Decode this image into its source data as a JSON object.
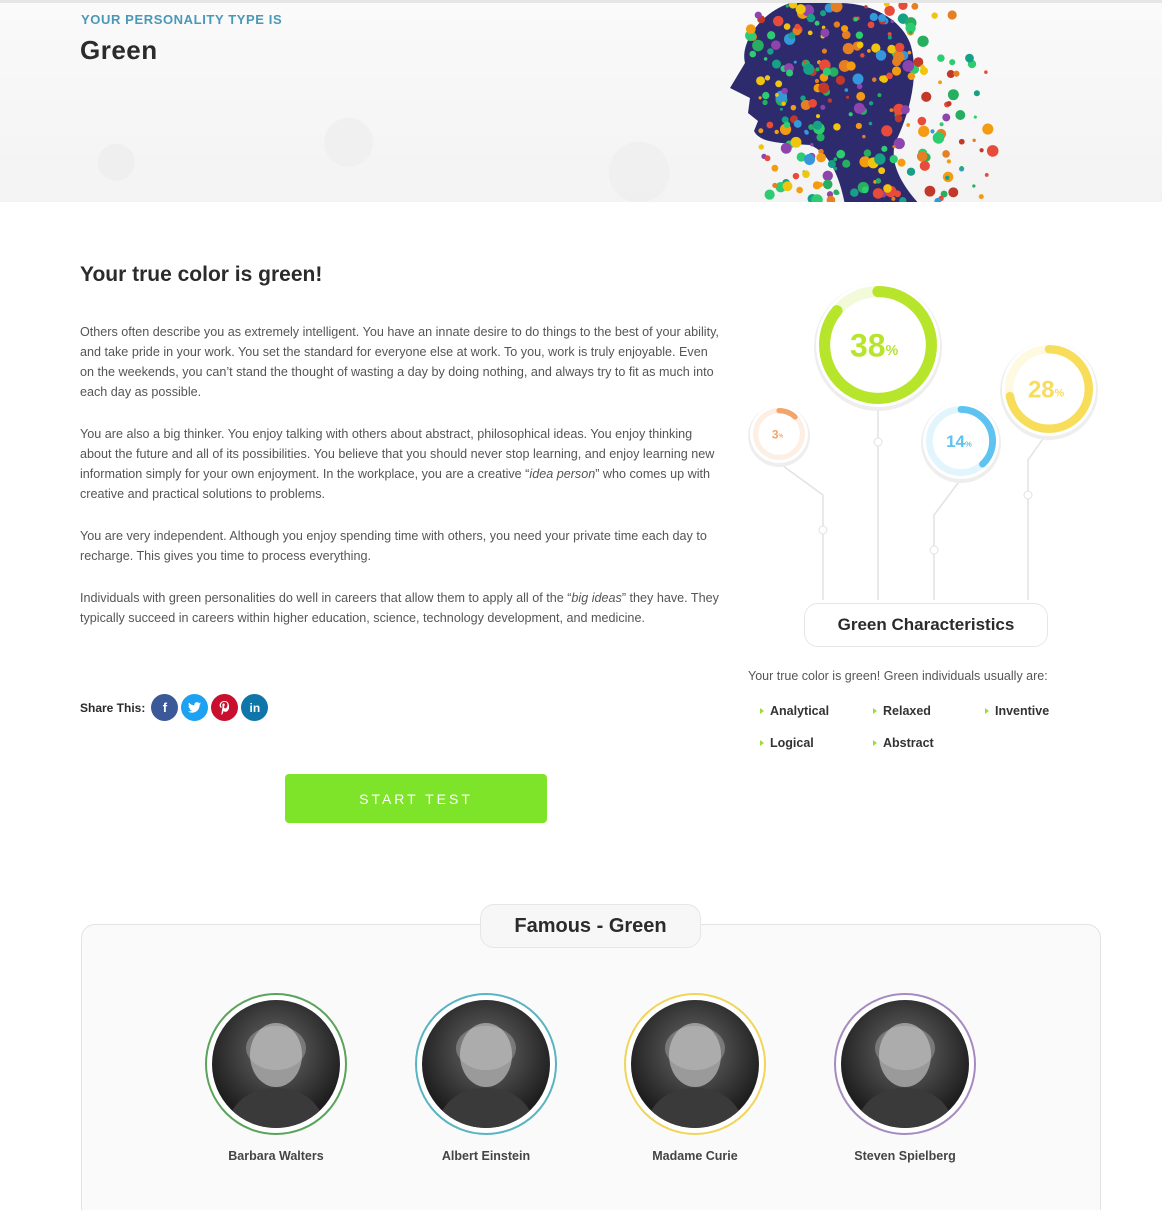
{
  "hero": {
    "kicker": "YOUR PERSONALITY TYPE IS",
    "title": "Green"
  },
  "article": {
    "heading": "Your true color is green!",
    "p1": "Others often describe you as extremely intelligent. You have an innate desire to do things to the best of your ability, and take pride in your work. You set the standard for everyone else at work. To you, work is truly enjoyable. Even on the weekends, you can’t stand the thought of wasting a day by doing nothing, and always try to fit as much into each day as possible.",
    "p2_a": "You are also a big thinker. You enjoy talking with others about abstract, philosophical ideas. You enjoy thinking about the future and all of its possibilities. You believe that you should never stop learning, and enjoy learning new information simply for your own enjoyment. In the workplace, you are a creative “",
    "p2_em": "idea person",
    "p2_b": "” who comes up with creative and practical solutions to problems.",
    "p3": "You are very independent. Although you enjoy spending time with others, you need your private time each day to recharge. This gives you time to process everything.",
    "p4_a": "Individuals with green personalities do well in careers that allow them to apply all of the “",
    "p4_em": "big ideas",
    "p4_b": "” they have. They typically succeed in careers within higher education, science, technology development, and medicine."
  },
  "share": {
    "label": "Share This:",
    "facebook": "f",
    "twitter": "t",
    "pinterest": "p",
    "linkedin": "in"
  },
  "cta": {
    "label": "START TEST"
  },
  "characteristics": {
    "title": "Green Characteristics",
    "intro": "Your true color is green! Green individuals usually are:",
    "traits": [
      "Analytical",
      "Relaxed",
      "Inventive",
      "Logical",
      "Abstract"
    ],
    "percent_sign": "%",
    "bubbles": [
      {
        "value": 38,
        "label": "38",
        "color": "#b7e52b"
      },
      {
        "value": 28,
        "label": "28",
        "color": "#f8dd5a"
      },
      {
        "value": 14,
        "label": "14",
        "color": "#5ec3f0"
      },
      {
        "value": 3,
        "label": "3",
        "color": "#f2a46b"
      }
    ]
  },
  "famous": {
    "title": "Famous - Green",
    "people": [
      {
        "name": "Barbara Walters",
        "ring_color": "#5aa35a"
      },
      {
        "name": "Albert Einstein",
        "ring_color": "#5ab3c0"
      },
      {
        "name": "Madame Curie",
        "ring_color": "#f0d55a"
      },
      {
        "name": "Steven Spielberg",
        "ring_color": "#a58bc0"
      }
    ]
  }
}
